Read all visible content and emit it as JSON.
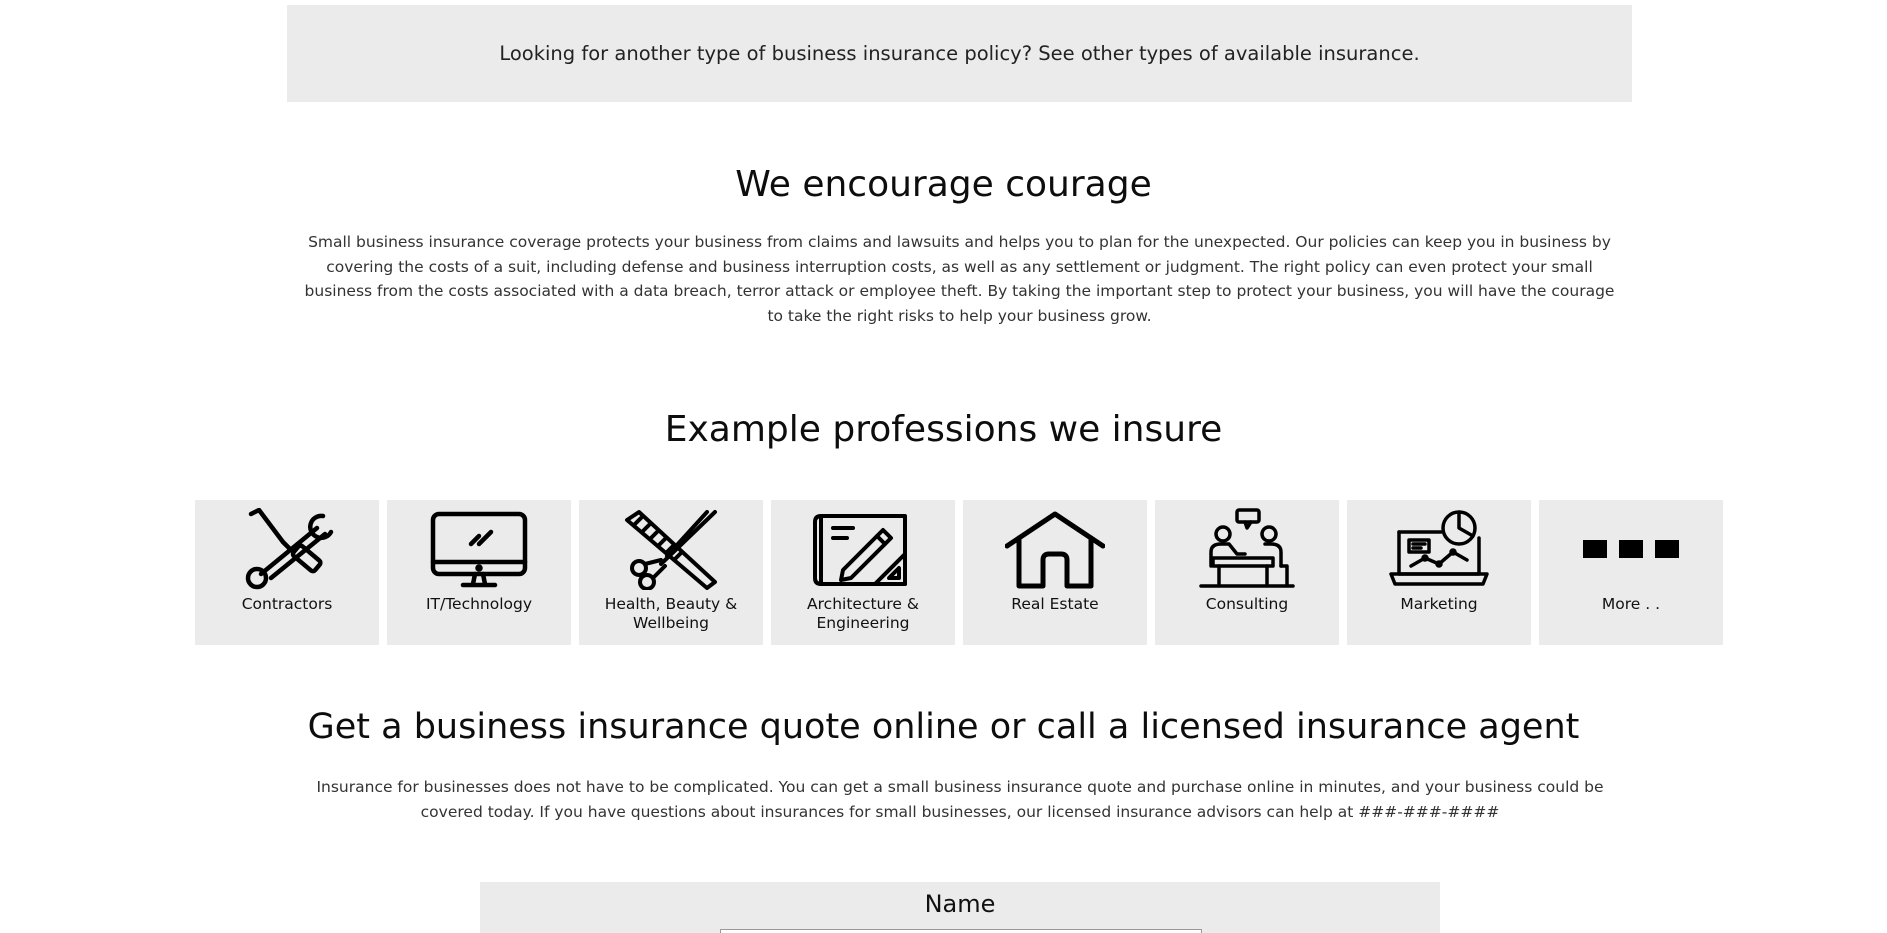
{
  "banner": {
    "text": "Looking for another type of business insurance policy? See other types of available insurance."
  },
  "courage": {
    "title": "We encourage courage",
    "body": "Small business insurance coverage protects your business from claims and lawsuits and helps you to plan for the unexpected. Our policies can keep you in business by covering the costs of a suit, including defense and business interruption costs, as well as any settlement or judgment. The right policy can even protect your small business from the costs associated with a data breach, terror attack or employee theft. By taking the important step to protect your business, you will have the courage to take the right risks to help your business grow."
  },
  "professions": {
    "title": "Example professions we insure",
    "items": [
      {
        "label": "Contractors",
        "icon": "wrench-screwdriver-icon"
      },
      {
        "label": "IT/Technology",
        "icon": "monitor-icon"
      },
      {
        "label": "Health, Beauty & Wellbeing",
        "icon": "comb-scissors-icon"
      },
      {
        "label": "Architecture & Engineering",
        "icon": "blueprint-icon"
      },
      {
        "label": "Real Estate",
        "icon": "house-icon"
      },
      {
        "label": "Consulting",
        "icon": "consulting-desk-icon"
      },
      {
        "label": "Marketing",
        "icon": "laptop-chart-icon"
      },
      {
        "label": "More . .",
        "icon": "more-dots-icon"
      }
    ]
  },
  "quote": {
    "title": "Get a business insurance quote online or call a licensed insurance agent",
    "body": "Insurance for businesses does not have to be complicated. You can get a small business insurance quote and purchase online in minutes, and your business could be covered today. If you have questions about insurances for small businesses, our licensed insurance advisors can help at ###-###-####"
  },
  "form": {
    "name_label": "Name",
    "name_value": ""
  },
  "colors": {
    "tile_background": "#ebebeb",
    "text": "#111111"
  }
}
